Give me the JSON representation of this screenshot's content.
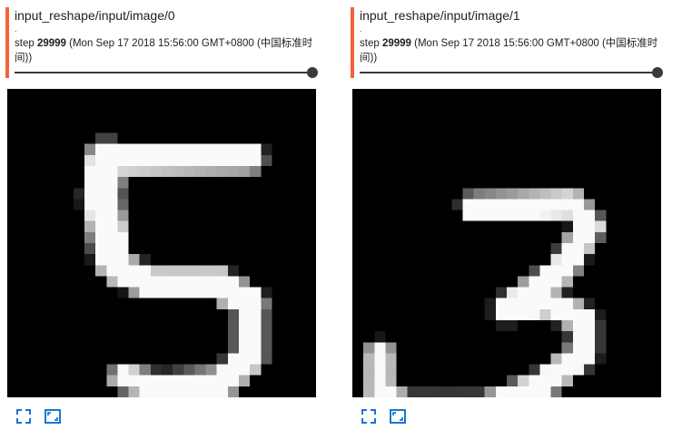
{
  "theme": {
    "accent": "#f4623a",
    "icon_color": "#1976d2",
    "slider_color": "#3a3a3a"
  },
  "cards": [
    {
      "title": "input_reshape/input/image/0",
      "dot": ".",
      "step_label": "step",
      "step_value": "29999",
      "timestamp": "(Mon Sep 17 2018 15:56:00 GMT+0800 (中国标准时间))",
      "slider_value": 1.0,
      "image_alt": "digit 5",
      "icons": [
        "fullscreen-icon",
        "fit-image-icon"
      ]
    },
    {
      "title": "input_reshape/input/image/1",
      "dot": ".",
      "step_label": "step",
      "step_value": "29999",
      "timestamp": "(Mon Sep 17 2018 15:56:00 GMT+0800 (中国标准时间))",
      "slider_value": 1.0,
      "image_alt": "digit 3",
      "icons": [
        "fullscreen-icon",
        "fit-image-icon"
      ]
    }
  ]
}
